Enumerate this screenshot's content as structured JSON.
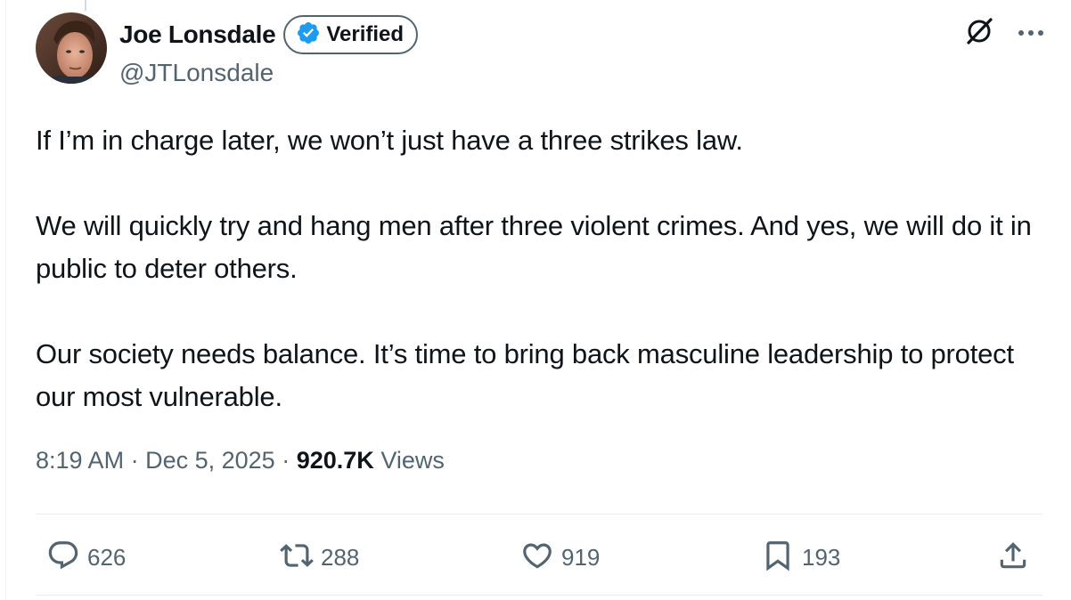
{
  "author": {
    "display_name": "Joe Lonsdale",
    "verified_label": "Verified",
    "handle": "@JTLonsdale"
  },
  "tweet": {
    "paragraphs": [
      "If I’m in charge later, we won’t just have a three strikes law.",
      "We will quickly try and hang men after three violent crimes. And yes, we will do it in public to deter others.",
      "Our society needs balance. It’s time to bring back masculine leadership to protect our most vulnerable."
    ],
    "time": "8:19 AM",
    "date": "Dec 5, 2025",
    "separator": "·",
    "views_count": "920.7K",
    "views_label": "Views"
  },
  "actions": {
    "replies": "626",
    "reposts": "288",
    "likes": "919",
    "bookmarks": "193"
  },
  "icons": {
    "verified": "verified-badge-icon",
    "grok": "grok-icon",
    "more": "more-icon",
    "reply": "reply-icon",
    "repost": "repost-icon",
    "like": "heart-icon",
    "bookmark": "bookmark-icon",
    "share": "share-icon"
  },
  "colors": {
    "text": "#0f1419",
    "secondary": "#536471",
    "verified_blue": "#1d9bf0",
    "divider": "#e7ecf0"
  }
}
